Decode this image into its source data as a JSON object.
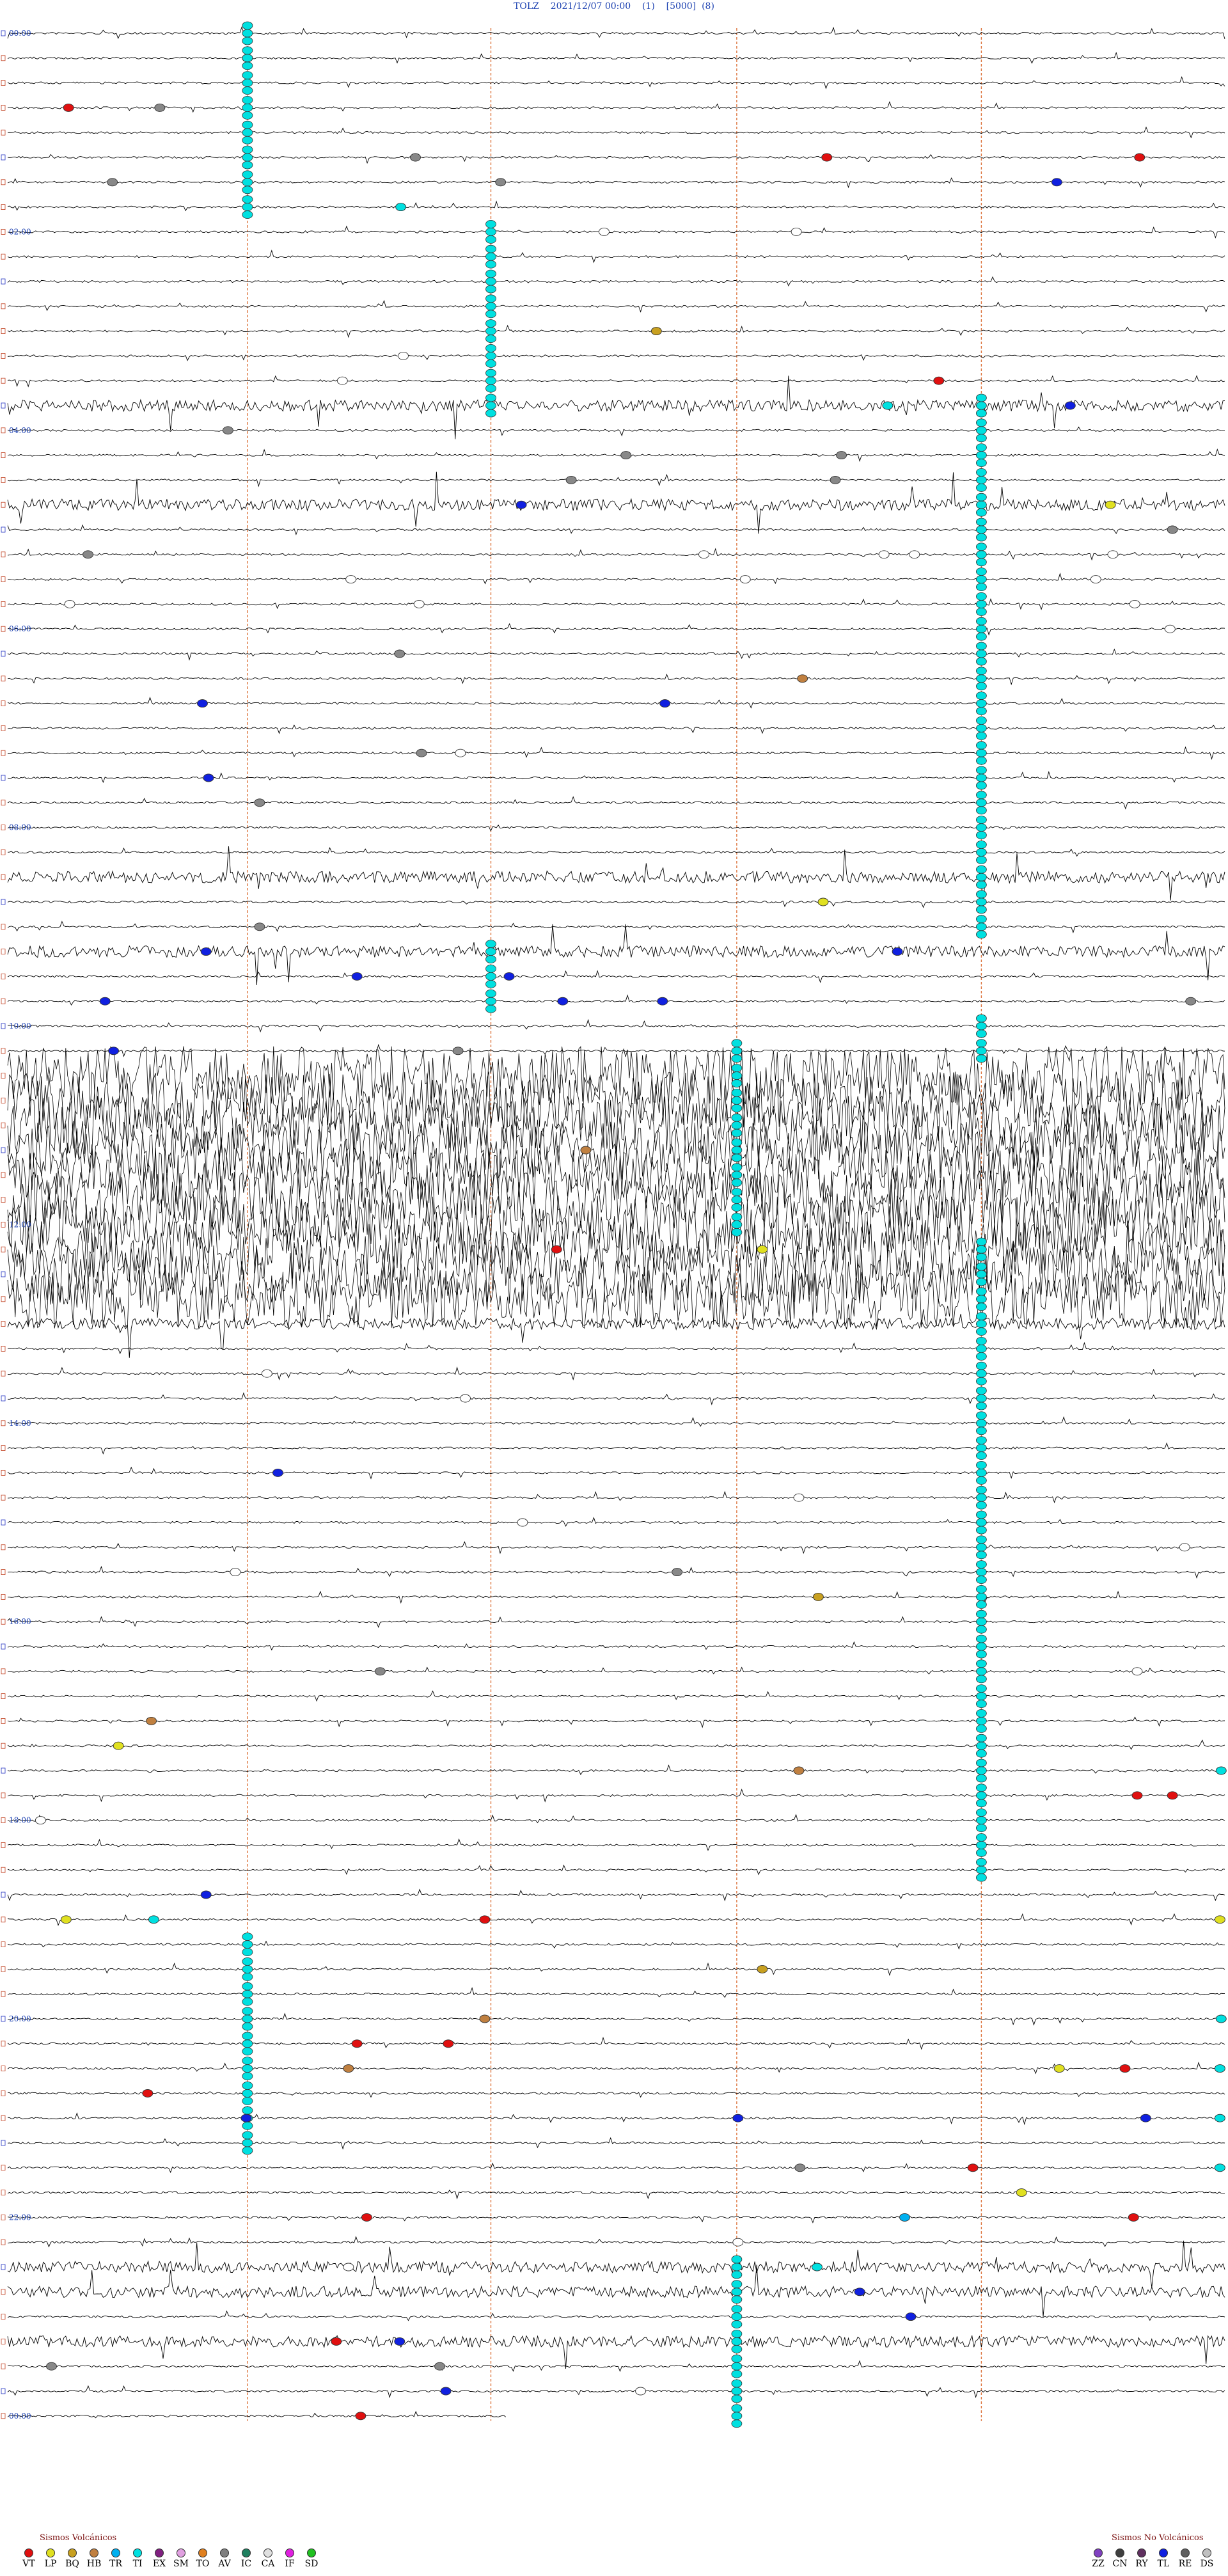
{
  "header": {
    "title": "TOLZ    2021/12/07 00:00    (1)    [5000]  (8)"
  },
  "chart_data": {
    "type": "helicorder",
    "station": "TOLZ",
    "date": "2021/12/07",
    "rows": 96,
    "time_labels": [
      "00:00",
      "02:00",
      "04:00",
      "06:00",
      "08:00",
      "10:00",
      "12:00",
      "14:00",
      "16:00",
      "18:00",
      "20:00",
      "22:00",
      "00:00"
    ],
    "noisy_rows": [
      42,
      43,
      44,
      45,
      46,
      47,
      48,
      49,
      50,
      51
    ],
    "moderate_rows": [
      15,
      19,
      34,
      37,
      50,
      51,
      52,
      90,
      91,
      93
    ],
    "event_markers": [
      {
        "row": 1,
        "t": 0.197,
        "c": "#00e0e0"
      },
      {
        "row": 1,
        "t": 0.197,
        "c": "#00e0e0"
      },
      {
        "row": 3,
        "t": 0.05,
        "c": "#e01010"
      },
      {
        "row": 3,
        "t": 0.125,
        "c": "#888888"
      },
      {
        "row": 5,
        "t": 0.335,
        "c": "#888888"
      },
      {
        "row": 5,
        "t": 0.673,
        "c": "#e01010"
      },
      {
        "row": 5,
        "t": 0.93,
        "c": "#e01010"
      },
      {
        "row": 6,
        "t": 0.086,
        "c": "#888888"
      },
      {
        "row": 6,
        "t": 0.405,
        "c": "#888888"
      },
      {
        "row": 6,
        "t": 0.862,
        "c": "#1020e0"
      },
      {
        "row": 7,
        "t": 0.323,
        "c": "#00e0e0"
      },
      {
        "row": 8,
        "t": 0.49,
        "c": "#ffffff"
      },
      {
        "row": 8,
        "t": 0.648,
        "c": "#ffffff"
      },
      {
        "row": 12,
        "t": 0.533,
        "c": "#c8a020"
      },
      {
        "row": 13,
        "t": 0.325,
        "c": "#ffffff"
      },
      {
        "row": 14,
        "t": 0.275,
        "c": "#ffffff"
      },
      {
        "row": 14,
        "t": 0.765,
        "c": "#e01010"
      },
      {
        "row": 15,
        "t": 0.873,
        "c": "#1020e0"
      },
      {
        "row": 15,
        "t": 0.723,
        "c": "#00e0e0"
      },
      {
        "row": 16,
        "t": 0.181,
        "c": "#888888"
      },
      {
        "row": 17,
        "t": 0.508,
        "c": "#888888"
      },
      {
        "row": 17,
        "t": 0.685,
        "c": "#888888"
      },
      {
        "row": 18,
        "t": 0.463,
        "c": "#888888"
      },
      {
        "row": 18,
        "t": 0.68,
        "c": "#888888"
      },
      {
        "row": 19,
        "t": 0.422,
        "c": "#1020e0"
      },
      {
        "row": 19,
        "t": 0.906,
        "c": "#e0e020"
      },
      {
        "row": 20,
        "t": 0.957,
        "c": "#888888"
      },
      {
        "row": 21,
        "t": 0.066,
        "c": "#888888"
      },
      {
        "row": 21,
        "t": 0.572,
        "c": "#ffffff"
      },
      {
        "row": 21,
        "t": 0.72,
        "c": "#ffffff"
      },
      {
        "row": 21,
        "t": 0.745,
        "c": "#ffffff"
      },
      {
        "row": 21,
        "t": 0.908,
        "c": "#ffffff"
      },
      {
        "row": 22,
        "t": 0.282,
        "c": "#ffffff"
      },
      {
        "row": 22,
        "t": 0.606,
        "c": "#ffffff"
      },
      {
        "row": 22,
        "t": 0.894,
        "c": "#ffffff"
      },
      {
        "row": 23,
        "t": 0.051,
        "c": "#ffffff"
      },
      {
        "row": 23,
        "t": 0.338,
        "c": "#ffffff"
      },
      {
        "row": 23,
        "t": 0.926,
        "c": "#ffffff"
      },
      {
        "row": 24,
        "t": 0.955,
        "c": "#ffffff"
      },
      {
        "row": 25,
        "t": 0.322,
        "c": "#888888"
      },
      {
        "row": 26,
        "t": 0.653,
        "c": "#c08040"
      },
      {
        "row": 27,
        "t": 0.16,
        "c": "#1020e0"
      },
      {
        "row": 27,
        "t": 0.54,
        "c": "#1020e0"
      },
      {
        "row": 29,
        "t": 0.34,
        "c": "#888888"
      },
      {
        "row": 29,
        "t": 0.372,
        "c": "#ffffff"
      },
      {
        "row": 30,
        "t": 0.165,
        "c": "#1020e0"
      },
      {
        "row": 31,
        "t": 0.207,
        "c": "#888888"
      },
      {
        "row": 35,
        "t": 0.67,
        "c": "#e0e020"
      },
      {
        "row": 36,
        "t": 0.207,
        "c": "#888888"
      },
      {
        "row": 37,
        "t": 0.163,
        "c": "#1020e0"
      },
      {
        "row": 37,
        "t": 0.731,
        "c": "#1020e0"
      },
      {
        "row": 38,
        "t": 0.287,
        "c": "#1020e0"
      },
      {
        "row": 38,
        "t": 0.412,
        "c": "#1020e0"
      },
      {
        "row": 39,
        "t": 0.08,
        "c": "#1020e0"
      },
      {
        "row": 39,
        "t": 0.456,
        "c": "#1020e0"
      },
      {
        "row": 39,
        "t": 0.538,
        "c": "#1020e0"
      },
      {
        "row": 39,
        "t": 0.972,
        "c": "#888888"
      },
      {
        "row": 41,
        "t": 0.087,
        "c": "#1020e0"
      },
      {
        "row": 41,
        "t": 0.37,
        "c": "#888888"
      },
      {
        "row": 45,
        "t": 0.475,
        "c": "#c08040"
      },
      {
        "row": 49,
        "t": 0.451,
        "c": "#e01010"
      },
      {
        "row": 49,
        "t": 0.62,
        "c": "#e0e020"
      },
      {
        "row": 54,
        "t": 0.213,
        "c": "#ffffff"
      },
      {
        "row": 55,
        "t": 0.376,
        "c": "#ffffff"
      },
      {
        "row": 58,
        "t": 0.222,
        "c": "#1020e0"
      },
      {
        "row": 59,
        "t": 0.65,
        "c": "#ffffff"
      },
      {
        "row": 60,
        "t": 0.423,
        "c": "#ffffff"
      },
      {
        "row": 61,
        "t": 0.967,
        "c": "#ffffff"
      },
      {
        "row": 62,
        "t": 0.187,
        "c": "#ffffff"
      },
      {
        "row": 62,
        "t": 0.55,
        "c": "#888888"
      },
      {
        "row": 63,
        "t": 0.666,
        "c": "#c8a020"
      },
      {
        "row": 66,
        "t": 0.306,
        "c": "#888888"
      },
      {
        "row": 66,
        "t": 0.928,
        "c": "#ffffff"
      },
      {
        "row": 68,
        "t": 0.118,
        "c": "#c08040"
      },
      {
        "row": 69,
        "t": 0.091,
        "c": "#e0e020"
      },
      {
        "row": 70,
        "t": 0.65,
        "c": "#c08040"
      },
      {
        "row": 70,
        "t": 0.997,
        "c": "#00e0e0"
      },
      {
        "row": 71,
        "t": 0.928,
        "c": "#e01010"
      },
      {
        "row": 71,
        "t": 0.957,
        "c": "#e01010"
      },
      {
        "row": 72,
        "t": 0.027,
        "c": "#ffffff"
      },
      {
        "row": 75,
        "t": 0.163,
        "c": "#1020e0"
      },
      {
        "row": 76,
        "t": 0.392,
        "c": "#e01010"
      },
      {
        "row": 76,
        "t": 0.996,
        "c": "#e0e020"
      },
      {
        "row": 76,
        "t": 0.048,
        "c": "#e0e020"
      },
      {
        "row": 76,
        "t": 0.12,
        "c": "#00e0e0"
      },
      {
        "row": 78,
        "t": 0.62,
        "c": "#c8a020"
      },
      {
        "row": 80,
        "t": 0.392,
        "c": "#c08040"
      },
      {
        "row": 80,
        "t": 0.997,
        "c": "#00e0e0"
      },
      {
        "row": 81,
        "t": 0.287,
        "c": "#e01010"
      },
      {
        "row": 81,
        "t": 0.362,
        "c": "#e01010"
      },
      {
        "row": 82,
        "t": 0.28,
        "c": "#c08040"
      },
      {
        "row": 82,
        "t": 0.864,
        "c": "#e0e020"
      },
      {
        "row": 82,
        "t": 0.918,
        "c": "#e01010"
      },
      {
        "row": 82,
        "t": 0.996,
        "c": "#00e0e0"
      },
      {
        "row": 83,
        "t": 0.115,
        "c": "#e01010"
      },
      {
        "row": 84,
        "t": 0.196,
        "c": "#1020e0"
      },
      {
        "row": 84,
        "t": 0.6,
        "c": "#1020e0"
      },
      {
        "row": 84,
        "t": 0.935,
        "c": "#1020e0"
      },
      {
        "row": 84,
        "t": 0.996,
        "c": "#00e0e0"
      },
      {
        "row": 86,
        "t": 0.651,
        "c": "#888888"
      },
      {
        "row": 86,
        "t": 0.793,
        "c": "#e01010"
      },
      {
        "row": 86,
        "t": 0.996,
        "c": "#00e0e0"
      },
      {
        "row": 87,
        "t": 0.833,
        "c": "#e0e020"
      },
      {
        "row": 88,
        "t": 0.295,
        "c": "#e01010"
      },
      {
        "row": 88,
        "t": 0.737,
        "c": "#00b0f0"
      },
      {
        "row": 88,
        "t": 0.925,
        "c": "#e01010"
      },
      {
        "row": 89,
        "t": 0.6,
        "c": "#ffffff"
      },
      {
        "row": 90,
        "t": 0.665,
        "c": "#00e0e0"
      },
      {
        "row": 90,
        "t": 0.28,
        "c": "#ffffff"
      },
      {
        "row": 91,
        "t": 0.7,
        "c": "#1020e0"
      },
      {
        "row": 92,
        "t": 0.742,
        "c": "#1020e0"
      },
      {
        "row": 93,
        "t": 0.27,
        "c": "#e01010"
      },
      {
        "row": 93,
        "t": 0.322,
        "c": "#1020e0"
      },
      {
        "row": 94,
        "t": 0.036,
        "c": "#888888"
      },
      {
        "row": 94,
        "t": 0.355,
        "c": "#888888"
      },
      {
        "row": 95,
        "t": 0.36,
        "c": "#1020e0"
      },
      {
        "row": 95,
        "t": 0.52,
        "c": "#ffffff"
      },
      {
        "row": 96,
        "t": 0.29,
        "c": "#e01010"
      }
    ],
    "marker_columns": [
      {
        "t": 0.197,
        "row_from": 0,
        "row_to": 7
      },
      {
        "t": 0.397,
        "row_from": 8,
        "row_to": 15
      },
      {
        "t": 0.8,
        "row_from": 15,
        "row_to": 36
      },
      {
        "t": 0.397,
        "row_from": 37,
        "row_to": 39
      },
      {
        "t": 0.8,
        "row_from": 40,
        "row_to": 41
      },
      {
        "t": 0.599,
        "row_from": 41,
        "row_to": 48
      },
      {
        "t": 0.8,
        "row_from": 49,
        "row_to": 74
      },
      {
        "t": 0.197,
        "row_from": 77,
        "row_to": 80
      },
      {
        "t": 0.197,
        "row_from": 81,
        "row_to": 85
      },
      {
        "t": 0.599,
        "row_from": 90,
        "row_to": 96
      }
    ]
  },
  "legend": {
    "volcanic_title": "Sismos Volcánicos",
    "nonvolcanic_title": "Sismos No Volcánicos",
    "volcanic": [
      {
        "code": "VT",
        "color": "#e01010"
      },
      {
        "code": "LP",
        "color": "#e0e020"
      },
      {
        "code": "BQ",
        "color": "#c8a020"
      },
      {
        "code": "HB",
        "color": "#c08040"
      },
      {
        "code": "TR",
        "color": "#00b0f0"
      },
      {
        "code": "TI",
        "color": "#00e0e0"
      },
      {
        "code": "EX",
        "color": "#802080"
      },
      {
        "code": "SM",
        "color": "#e0a0e0"
      },
      {
        "code": "TO",
        "color": "#e08020"
      },
      {
        "code": "AV",
        "color": "#808080"
      },
      {
        "code": "IC",
        "color": "#208060"
      },
      {
        "code": "CA",
        "color": "#e0e0e0"
      },
      {
        "code": "IF",
        "color": "#e020e0"
      },
      {
        "code": "SD",
        "color": "#20c020"
      }
    ],
    "nonvolcanic": [
      {
        "code": "ZZ",
        "color": "#8040c0"
      },
      {
        "code": "CN",
        "color": "#404040"
      },
      {
        "code": "RY",
        "color": "#603060"
      },
      {
        "code": "TL",
        "color": "#1020e0"
      },
      {
        "code": "RE",
        "color": "#606060"
      },
      {
        "code": "DS",
        "color": "#c0c0c0"
      }
    ]
  }
}
